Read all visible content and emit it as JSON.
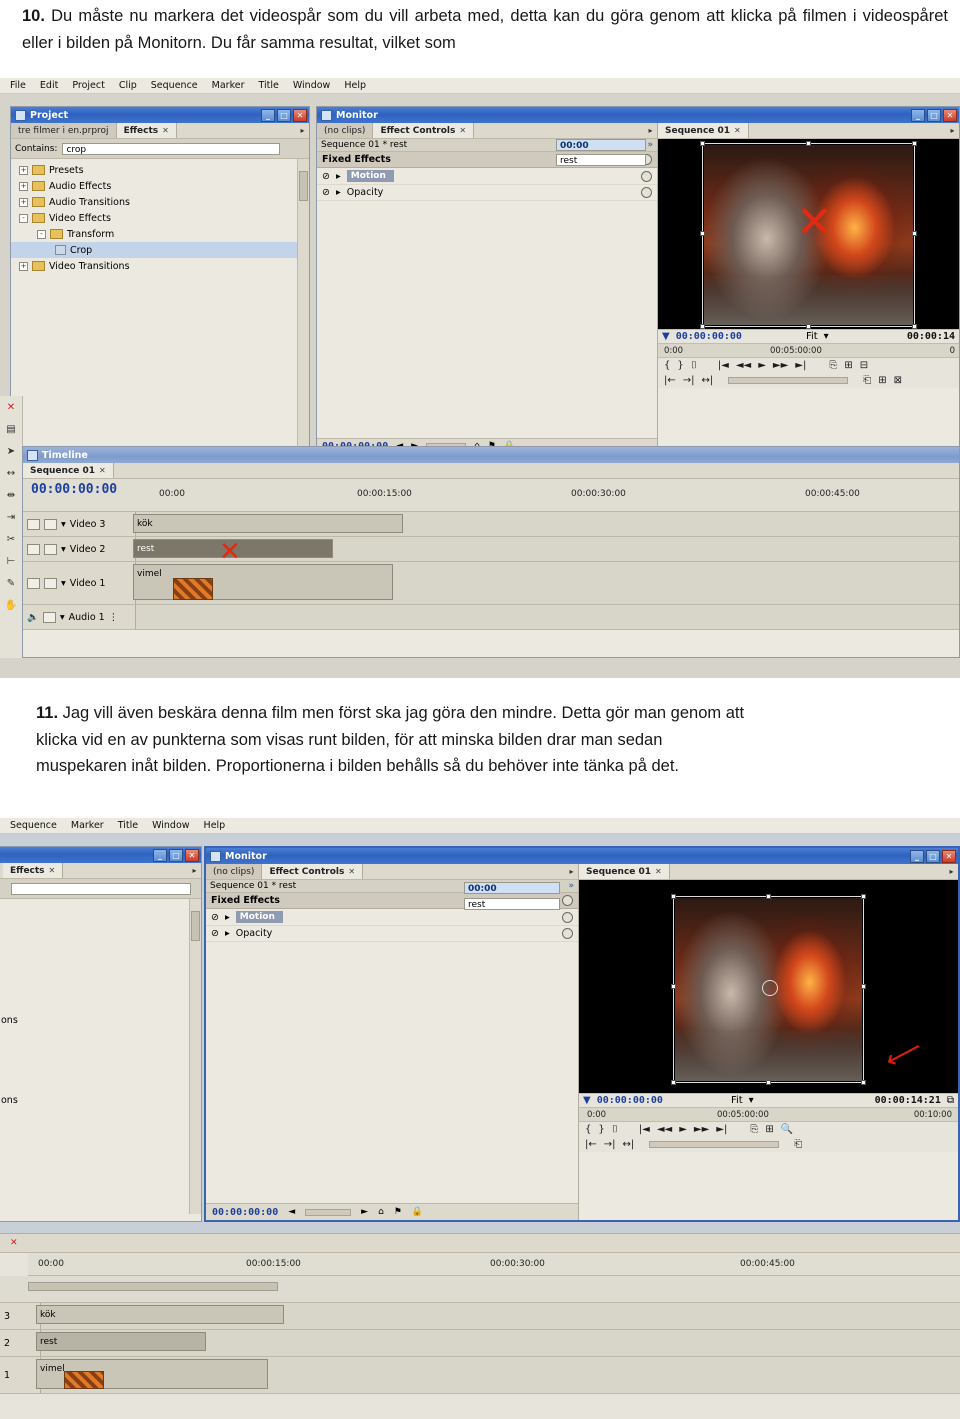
{
  "document": {
    "paragraphs": [
      {
        "number": "10.",
        "text": "Du måste nu markera det videospår som du vill arbeta med, detta kan du göra genom att klicka på filmen i videospåret eller i bilden på Monitorn. Du får samma resultat, vilket som"
      },
      {
        "number": "11.",
        "text": "Jag vill även beskära denna film men först ska jag göra den mindre. Detta gör man genom att",
        "line2": "klicka vid en av punkterna som visas runt bilden, för att minska bilden drar man sedan",
        "line3": "muspekaren inåt bilden. Proportionerna i bilden behålls så du behöver inte tänka på det."
      }
    ]
  },
  "screenshot1": {
    "menubar": [
      "File",
      "Edit",
      "Project",
      "Clip",
      "Sequence",
      "Marker",
      "Title",
      "Window",
      "Help"
    ],
    "project_window": {
      "title": "Project",
      "tabs": [
        {
          "label": "tre filmer i en.prproj",
          "closable": false,
          "active": false
        },
        {
          "label": "Effects",
          "closable": true,
          "active": true
        }
      ],
      "contains_label": "Contains:",
      "contains_value": "crop",
      "tree": [
        {
          "label": "Presets",
          "type": "folder",
          "expander": "+",
          "indent": 0,
          "selected": false
        },
        {
          "label": "Audio Effects",
          "type": "folder",
          "expander": "+",
          "indent": 0,
          "selected": false
        },
        {
          "label": "Audio Transitions",
          "type": "folder",
          "expander": "+",
          "indent": 0,
          "selected": false
        },
        {
          "label": "Video Effects",
          "type": "folder",
          "expander": "-",
          "indent": 0,
          "selected": false
        },
        {
          "label": "Transform",
          "type": "folder",
          "expander": "-",
          "indent": 1,
          "selected": false
        },
        {
          "label": "Crop",
          "type": "effect",
          "expander": "",
          "indent": 2,
          "selected": true
        },
        {
          "label": "Video Transitions",
          "type": "folder",
          "expander": "+",
          "indent": 0,
          "selected": false
        }
      ]
    },
    "monitor_window": {
      "title": "Monitor",
      "left_tabs": [
        {
          "label": "(no clips)",
          "active": false
        },
        {
          "label": "Effect Controls",
          "active": true,
          "closable": true
        }
      ],
      "right_tabs": [
        {
          "label": "Sequence 01",
          "active": true,
          "closable": true
        }
      ],
      "sequence_label": "Sequence 01 * rest",
      "fixed_effects_label": "Fixed Effects",
      "effects": [
        "Motion",
        "Opacity"
      ],
      "source_timecode_top": "00:00",
      "source_clip_name": "rest",
      "bottom_timecode": "00:00:00:00",
      "program": {
        "current_timecode": "00:00:00:00",
        "fit_label": "Fit",
        "duration_timecode": "00:00:14",
        "ruler_marks": [
          "0:00",
          "00:05:00:00",
          "0"
        ]
      }
    },
    "timeline_window": {
      "title": "Timeline",
      "tabs": [
        {
          "label": "Sequence 01",
          "active": true,
          "closable": true
        }
      ],
      "playhead_timecode": "00:00:00:00",
      "ruler_marks": [
        "00:00",
        "00:00:15:00",
        "00:00:30:00",
        "00:00:45:00"
      ],
      "tracks": [
        {
          "name": "Video 3",
          "clip": "kök"
        },
        {
          "name": "Video 2",
          "clip": "rest"
        },
        {
          "name": "Video 1",
          "clip": "vimel"
        },
        {
          "name": "Audio 1",
          "clip": ""
        }
      ]
    }
  },
  "screenshot2": {
    "menubar": [
      "Sequence",
      "Marker",
      "Title",
      "Window",
      "Help"
    ],
    "left_window": {
      "tabs": [
        {
          "label": "Effects",
          "active": true,
          "closable": true
        }
      ],
      "tree_fragments": [
        "ons",
        "ons"
      ]
    },
    "monitor_window": {
      "title": "Monitor",
      "left_tabs": [
        {
          "label": "(no clips)",
          "active": false
        },
        {
          "label": "Effect Controls",
          "active": true,
          "closable": true
        }
      ],
      "right_tabs": [
        {
          "label": "Sequence 01",
          "active": true,
          "closable": true
        }
      ],
      "sequence_label": "Sequence 01 * rest",
      "fixed_effects_label": "Fixed Effects",
      "effects": [
        "Motion",
        "Opacity"
      ],
      "source_timecode_top": "00:00",
      "source_clip_name": "rest",
      "bottom_timecode": "00:00:00:00",
      "program": {
        "current_timecode": "00:00:00:00",
        "fit_label": "Fit",
        "duration_timecode": "00:00:14:21",
        "ruler_marks": [
          "0:00",
          "00:05:00:00",
          "00:10:00"
        ]
      }
    },
    "timeline_window": {
      "ruler_marks": [
        "00:00",
        "00:00:15:00",
        "00:00:30:00",
        "00:00:45:00"
      ],
      "tracks": [
        {
          "name": "3",
          "clip": "kök"
        },
        {
          "name": "2",
          "clip": "rest"
        },
        {
          "name": "1",
          "clip": "vimel"
        }
      ]
    }
  }
}
